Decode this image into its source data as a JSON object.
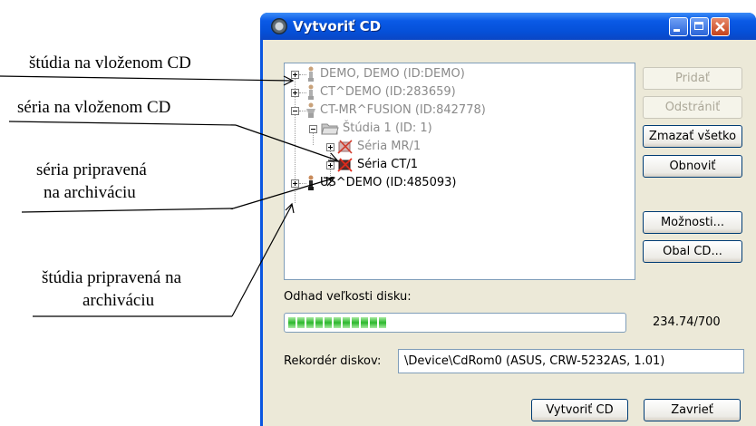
{
  "annotations": {
    "studies_on_cd": "štúdia na vloženom CD",
    "series_on_cd": "séria na vloženom CD",
    "series_ready_line1": "séria pripravená",
    "series_ready_line2": "na archiváciu",
    "study_ready_line1": "štúdia pripravená na",
    "study_ready_line2": "archiváciu"
  },
  "window": {
    "title": "Vytvoriť CD",
    "minimize_icon": "minimize-icon",
    "maximize_icon": "maximize-icon",
    "close_icon": "close-icon"
  },
  "tree": {
    "nodes": [
      {
        "label": "DEMO, DEMO (ID:DEMO)",
        "icon": "patient-icon",
        "expander": "plus",
        "state": "on-cd"
      },
      {
        "label": "CT^DEMO (ID:283659)",
        "icon": "patient-icon",
        "expander": "plus",
        "state": "on-cd"
      },
      {
        "label": "CT-MR^FUSION (ID:842778)",
        "icon": "patient-icon",
        "expander": "minus",
        "state": "on-cd"
      },
      {
        "label": "Štúdia 1 (ID: 1)",
        "icon": "folder-icon",
        "expander": "minus",
        "state": "on-cd"
      },
      {
        "label": "Séria MR/1",
        "icon": "series-icon",
        "expander": "plus",
        "state": "on-cd"
      },
      {
        "label": "Séria CT/1",
        "icon": "series-icon",
        "expander": "plus",
        "state": "ready"
      },
      {
        "label": "US^DEMO (ID:485093)",
        "icon": "patient-icon",
        "expander": "plus",
        "state": "ready"
      }
    ]
  },
  "buttons": {
    "add": "Pridať",
    "remove": "Odstrániť",
    "clear_all": "Zmazať všetko",
    "refresh": "Obnoviť",
    "options": "Možnosti...",
    "cd_cover": "Obal CD...",
    "create_cd": "Vytvoriť CD",
    "close": "Zavrieť"
  },
  "disk": {
    "label": "Odhad veľkosti disku:",
    "value": "234.74/700",
    "progress_segments": 11
  },
  "recorder": {
    "label": "Rekordér diskov:",
    "value": "\\Device\\CdRom0 (ASUS, CRW-5232AS, 1.01)"
  },
  "colors": {
    "title_bar": "#0a5ae6",
    "dialog_bg": "#ece9d8",
    "progress_fill": "#2cb82c",
    "on_cd_text": "#8a8a8a",
    "ready_text": "#000000"
  }
}
